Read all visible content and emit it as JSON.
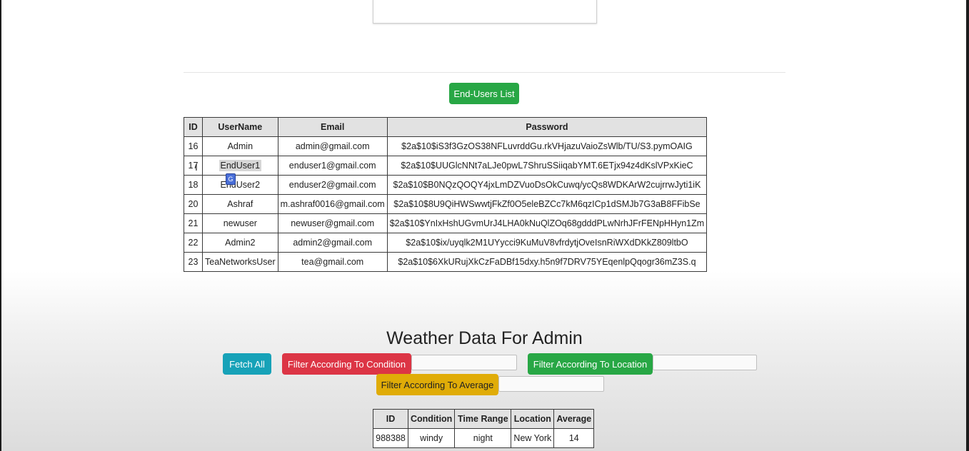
{
  "end_users_button": "End-Users List",
  "users_table": {
    "headers": [
      "ID",
      "UserName",
      "Email",
      "Password"
    ],
    "rows": [
      [
        "16",
        "Admin",
        "admin@gmail.com",
        "$2a$10$iS3f3GzOS38NFLuvrddGu.rkVHjazuVaioZsWlb/TU/S3.pymOAIG"
      ],
      [
        "17",
        "EndUser1",
        "enduser1@gmail.com",
        "$2a$10$UUGlcNNt7aLJe0pwL7ShruSSiiqabYMT.6ETjx94z4dKslVPxKieC"
      ],
      [
        "18",
        "EndUser2",
        "enduser2@gmail.com",
        "$2a$10$B0NQzQOQY4jxLmDZVuoDsOkCuwq/ycQs8WDKArW2cujrrwJyti1iK"
      ],
      [
        "20",
        "Ashraf",
        "m.ashraf0016@gmail.com",
        "$2a$10$8U9QiHWSwwtjFkZf0O5eleBZCc7kM6qzICp1dSMJb7G3aB8FFibSe"
      ],
      [
        "21",
        "newuser",
        "newuser@gmail.com",
        "$2a$10$YnIxHshUGvmUrJ4LHA0kNuQlZOq68gdddPLwNrhJFrFENpHHyn1Zm"
      ],
      [
        "22",
        "Admin2",
        "admin2@gmail.com",
        "$2a$10$ix/uyqlk2M1UYycci9KuMuV8vfrdytjOveIsnRiWXdDKkZ809ltbO"
      ],
      [
        "23",
        "TeaNetworksUser",
        "tea@gmail.com",
        "$2a$10$6XkURujXkCzFaDBf15dxy.h5n9f7DRV75YEqenlpQqogr36mZ3S.q"
      ]
    ]
  },
  "weather": {
    "title": "Weather Data For Admin",
    "fetch_all": "Fetch All",
    "filter_condition": "Filter According To Condition",
    "filter_location": "Filter According To Location",
    "filter_average": "Filter According To Average",
    "headers": [
      "ID",
      "Condition",
      "Time Range",
      "Location",
      "Average"
    ],
    "rows": [
      [
        "988388",
        "windy",
        "night",
        "New York",
        "14"
      ]
    ]
  },
  "colors": {
    "green": "#28a745",
    "teal": "#17a2b8",
    "red": "#dc3545",
    "yellow": "#e0ac08"
  },
  "icons": {
    "text_cursor": "I",
    "drag_indicator": "G"
  }
}
